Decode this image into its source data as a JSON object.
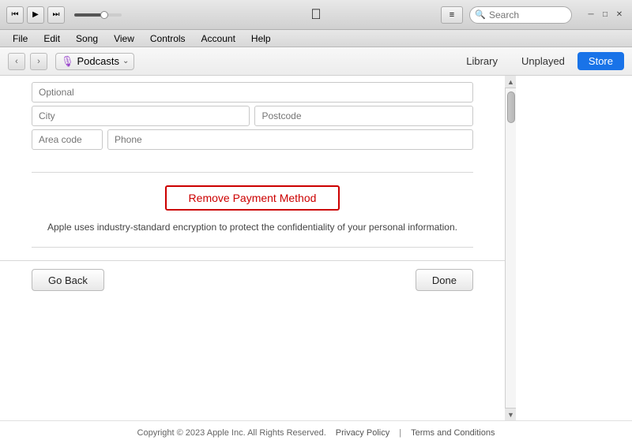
{
  "titlebar": {
    "rewind_label": "⏮",
    "play_label": "▶",
    "fastforward_label": "⏭",
    "list_icon": "≡",
    "apple_logo": "",
    "search_placeholder": "Search"
  },
  "menubar": {
    "items": [
      "File",
      "Edit",
      "Song",
      "View",
      "Controls",
      "Account",
      "Help"
    ]
  },
  "navbar": {
    "back_arrow": "‹",
    "forward_arrow": "›",
    "podcast_icon": "🎙",
    "podcast_label": "Podcasts",
    "dropdown_icon": "⌃",
    "tabs": [
      {
        "label": "Library",
        "active": false
      },
      {
        "label": "Unplayed",
        "active": false
      },
      {
        "label": "Store",
        "active": true
      }
    ]
  },
  "form": {
    "optional_placeholder": "Optional",
    "city_placeholder": "City",
    "postcode_placeholder": "Postcode",
    "area_code_placeholder": "Area code",
    "phone_placeholder": "Phone"
  },
  "remove_button": {
    "label": "Remove Payment Method"
  },
  "notice": {
    "text": "Apple uses industry-standard encryption to protect the confidentiality of your personal information."
  },
  "actions": {
    "go_back_label": "Go Back",
    "done_label": "Done"
  },
  "footer": {
    "copyright": "Copyright © 2023 Apple Inc. All Rights Reserved.",
    "privacy": "Privacy Policy",
    "separator": "|",
    "terms": "Terms and Conditions"
  }
}
